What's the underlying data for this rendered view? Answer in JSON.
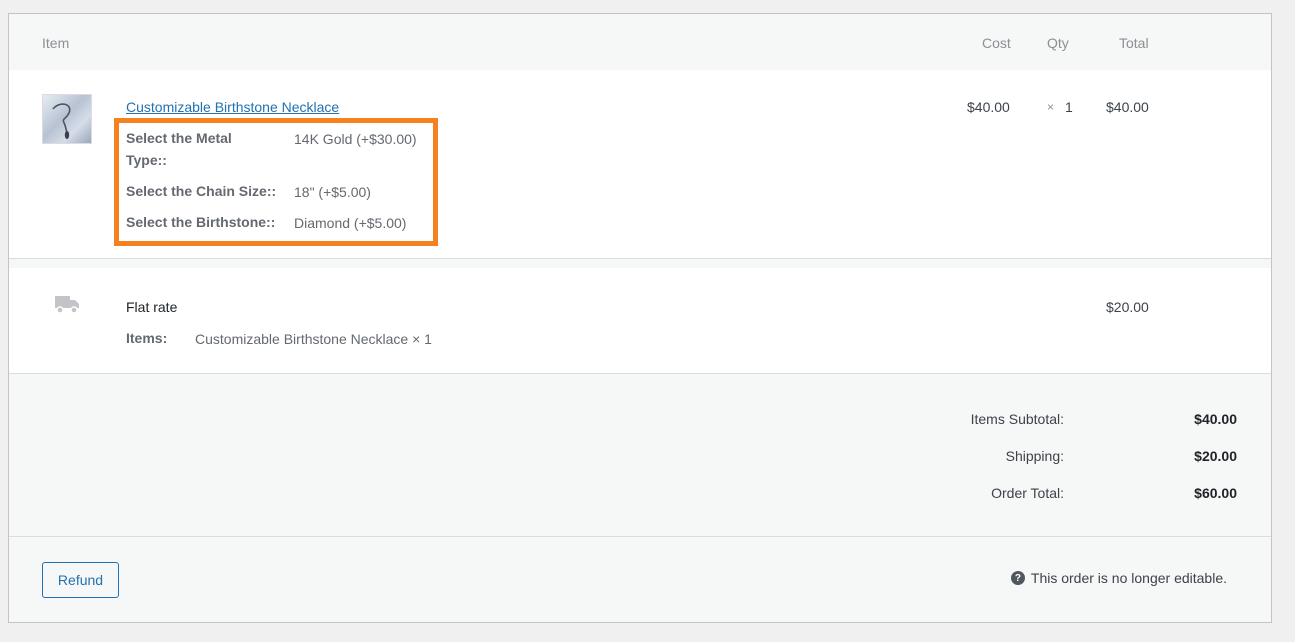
{
  "header": {
    "item": "Item",
    "cost": "Cost",
    "qty": "Qty",
    "total": "Total"
  },
  "line_item": {
    "name": "Customizable Birthstone Necklace",
    "cost": "$40.00",
    "qty_sep": "×",
    "qty": "1",
    "total": "$40.00",
    "meta": [
      {
        "key": "Select the Metal Type::",
        "value": "14K Gold (+$30.00)"
      },
      {
        "key": "Select the Chain Size::",
        "value": "18\" (+$5.00)"
      },
      {
        "key": "Select the Birthstone::",
        "value": "Diamond (+$5.00)"
      }
    ]
  },
  "shipping_line": {
    "icon": "truck-icon",
    "name": "Flat rate",
    "items_label": "Items:",
    "items_value": "Customizable Birthstone Necklace × 1",
    "total": "$20.00"
  },
  "totals": {
    "subtotal_label": "Items Subtotal:",
    "subtotal_value": "$40.00",
    "shipping_label": "Shipping:",
    "shipping_value": "$20.00",
    "order_total_label": "Order Total:",
    "order_total_value": "$60.00"
  },
  "actions": {
    "refund_label": "Refund",
    "notice_icon": "help-icon",
    "notice_text": "This order is no longer editable."
  },
  "colors": {
    "link": "#2271b1",
    "highlight_border": "#f5811f",
    "panel_bg": "#f6f7f7"
  }
}
